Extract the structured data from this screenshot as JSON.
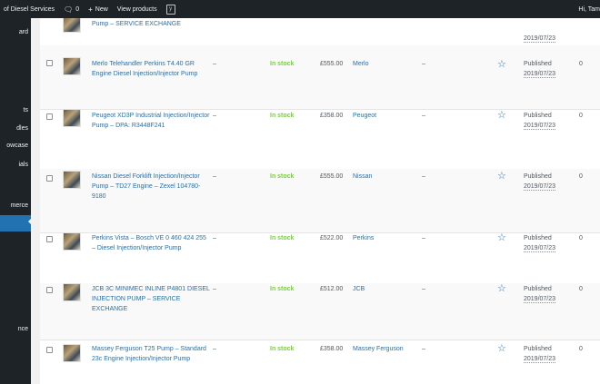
{
  "admin_bar": {
    "site_name": "of Diesel Services",
    "comments_count": "0",
    "new_label": "New",
    "view_products_label": "View products",
    "greeting": "Hi, Tam"
  },
  "sidebar": {
    "items": [
      "ard",
      "ts",
      "dles",
      "owcase",
      "ials",
      "merce",
      "",
      "nce"
    ]
  },
  "products": [
    {
      "name": "Pump – SERVICE EXCHANGE",
      "sku": "",
      "stock": "",
      "price": "",
      "category": "",
      "tag": "",
      "status": "",
      "date": "2019/07/23",
      "views": ""
    },
    {
      "name": "Merlo Telehandler Perkins T4.40 GR Engine Diesel Injection/Injector Pump",
      "sku": "–",
      "stock": "In stock",
      "price": "£555.00",
      "category": "Merlo",
      "tag": "–",
      "status": "Published",
      "date": "2019/07/23",
      "views": "0"
    },
    {
      "name": "Peugeot XD3P Industrial Injection/Injector Pump – DPA: R3448F241",
      "sku": "–",
      "stock": "In stock",
      "price": "£358.00",
      "category": "Peugeot",
      "tag": "–",
      "status": "Published",
      "date": "2019/07/23",
      "views": "0"
    },
    {
      "name": "Nissan Diesel Forklift Injection/Injector Pump – TD27 Engine – Zexel 104780-9180",
      "sku": "–",
      "stock": "In stock",
      "price": "£555.00",
      "category": "Nissan",
      "tag": "–",
      "status": "Published",
      "date": "2019/07/23",
      "views": "0"
    },
    {
      "name": "Perkins Vista – Bosch VE 0 460 424 255 – Diesel Injection/Injector Pump",
      "sku": "–",
      "stock": "In stock",
      "price": "£522.00",
      "category": "Perkins",
      "tag": "–",
      "status": "Published",
      "date": "2019/07/23",
      "views": "0"
    },
    {
      "name": "JCB 3C MINIMEC INLINE P4801 DIESEL INJECTION PUMP – SERVICE EXCHANGE",
      "sku": "–",
      "stock": "In stock",
      "price": "£512.00",
      "category": "JCB",
      "tag": "–",
      "status": "Published",
      "date": "2019/07/23",
      "views": "0"
    },
    {
      "name": "Massey Ferguson T25 Pump – Standard 23c Engine Injection/Injector Pump",
      "sku": "–",
      "stock": "In stock",
      "price": "£358.00",
      "category": "Massey Ferguson",
      "tag": "–",
      "status": "Published",
      "date": "2019/07/23",
      "views": "0"
    }
  ]
}
